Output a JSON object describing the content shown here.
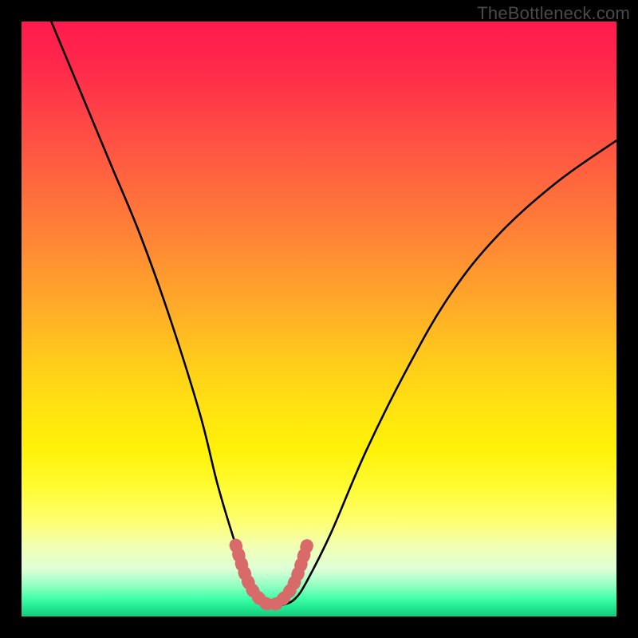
{
  "watermark": "TheBottleneck.com",
  "chart_data": {
    "type": "line",
    "title": "",
    "xlabel": "",
    "ylabel": "",
    "xlim": [
      0,
      100
    ],
    "ylim": [
      0,
      100
    ],
    "series": [
      {
        "name": "bottleneck-curve",
        "x": [
          5,
          10,
          15,
          20,
          25,
          30,
          33,
          36,
          38,
          40,
          42,
          44,
          46,
          48,
          52,
          58,
          65,
          72,
          80,
          90,
          100
        ],
        "y": [
          100,
          88,
          76,
          64,
          50,
          34,
          22,
          12,
          6,
          3,
          2,
          2,
          3,
          6,
          14,
          28,
          42,
          54,
          64,
          73,
          80
        ]
      }
    ],
    "highlight": {
      "name": "optimal-zone",
      "x": [
        36,
        38,
        40,
        42,
        44,
        46,
        48
      ],
      "y": [
        12,
        6,
        3,
        2,
        3,
        6,
        12
      ]
    }
  }
}
